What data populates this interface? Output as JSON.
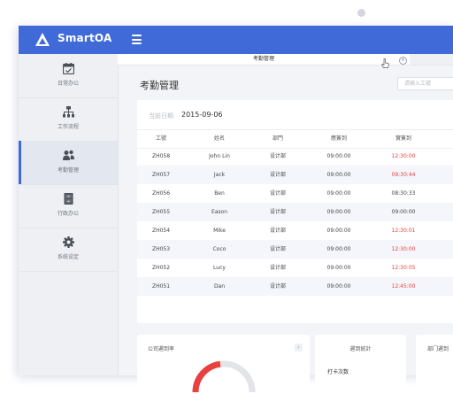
{
  "app": {
    "name": "SmartOA"
  },
  "sidebar": {
    "items": [
      {
        "label": "日常办公",
        "icon": "calendar-icon",
        "active": false
      },
      {
        "label": "工作流程",
        "icon": "workflow-icon",
        "active": false
      },
      {
        "label": "考勤管理",
        "icon": "users-icon",
        "active": true
      },
      {
        "label": "行政办公",
        "icon": "cabinet-icon",
        "active": false
      },
      {
        "label": "系统设定",
        "icon": "gear-icon",
        "active": false
      }
    ]
  },
  "tabs": {
    "active_label": "考勤管理",
    "close_symbol": "×"
  },
  "page": {
    "title": "考勤管理",
    "search_placeholder": "请输入工號"
  },
  "attendance": {
    "date_label": "当前日期",
    "date_value": "2015-09-06",
    "columns": [
      "工號",
      "姓名",
      "部門",
      "應簽到",
      "實簽到"
    ],
    "rows": [
      {
        "id": "ZH058",
        "name": "John Lin",
        "dept": "设计部",
        "expected": "09:00:00",
        "actual": "12:30:00",
        "late": true
      },
      {
        "id": "ZH057",
        "name": "Jack",
        "dept": "设计部",
        "expected": "09:00:00",
        "actual": "09:30:44",
        "late": true
      },
      {
        "id": "ZH056",
        "name": "Ben",
        "dept": "设计部",
        "expected": "09:00:00",
        "actual": "08:30:33",
        "late": false
      },
      {
        "id": "ZH055",
        "name": "Eason",
        "dept": "设计部",
        "expected": "09:00:00",
        "actual": "09:00:00",
        "late": false
      },
      {
        "id": "ZH054",
        "name": "Mike",
        "dept": "设计部",
        "expected": "09:00:00",
        "actual": "12:30:01",
        "late": true
      },
      {
        "id": "ZH053",
        "name": "Coco",
        "dept": "设计部",
        "expected": "09:00:00",
        "actual": "12:30:00",
        "late": true
      },
      {
        "id": "ZH052",
        "name": "Lucy",
        "dept": "设计部",
        "expected": "09:00:00",
        "actual": "12:30:05",
        "late": true
      },
      {
        "id": "ZH051",
        "name": "Dan",
        "dept": "设计部",
        "expected": "09:00:00",
        "actual": "12:45:00",
        "late": true
      }
    ]
  },
  "cards": {
    "rate": {
      "title": "公司遲到率",
      "arrow": "›"
    },
    "stats": {
      "title": "遲到統計",
      "item": "打卡次数"
    },
    "dept": {
      "title": "部门遲到"
    }
  },
  "colors": {
    "primary": "#3f6ad8",
    "late": "#e8413f",
    "gauge": "#e8413f"
  }
}
